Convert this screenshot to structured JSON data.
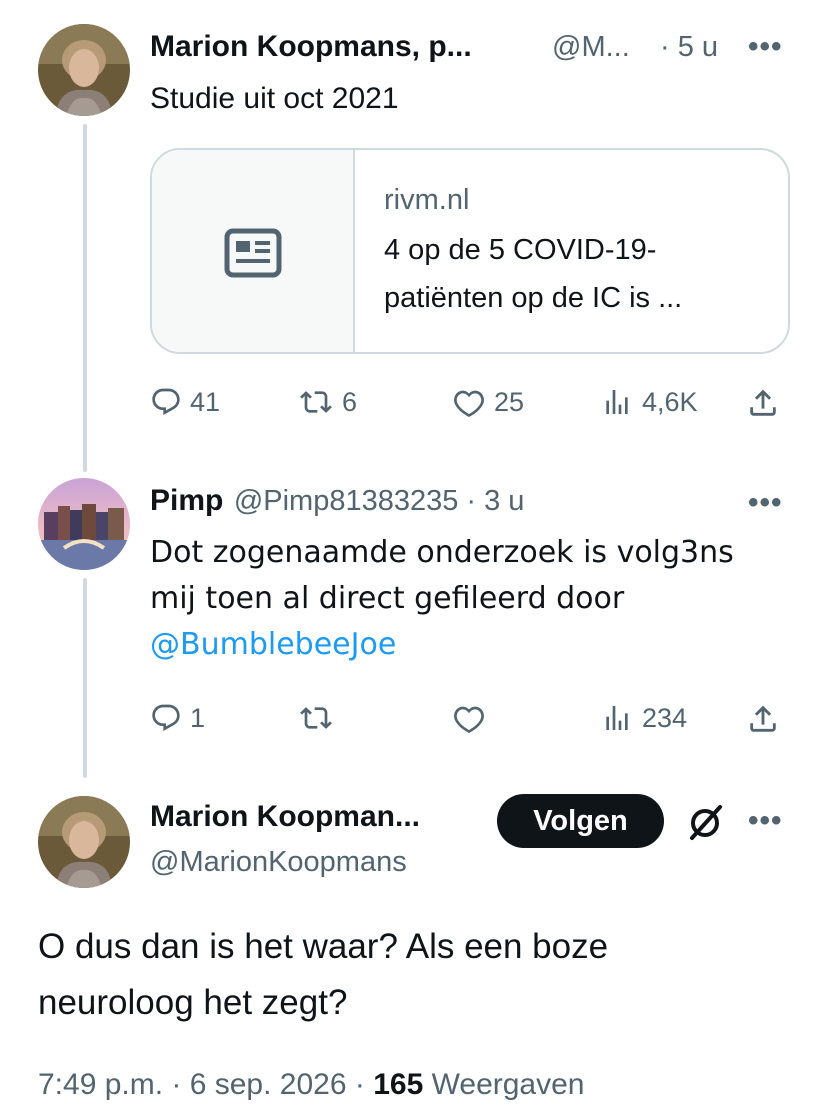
{
  "tweets": [
    {
      "name": "Marion Koopmans, p...",
      "handle": "@M...",
      "time": "· 5 u",
      "text": "Studie uit oct 2021",
      "card": {
        "domain": "rivm.nl",
        "title_line1": "4 op de 5 COVID-19-",
        "title_line2": "patiënten op de IC is ..."
      },
      "actions": {
        "replies": "41",
        "reposts": "6",
        "likes": "25",
        "views": "4,6K"
      }
    },
    {
      "name": "Pimp",
      "handle_time": "@Pimp81383235 · 3 u",
      "text_line1": "Dot zogenaamde onderzoek is volg3ns",
      "text_line2": "mij toen al direct gefileerd door",
      "mention": "@BumblebeeJoe",
      "actions": {
        "replies": "1",
        "reposts": "",
        "likes": "",
        "views": "234"
      }
    }
  ],
  "main_tweet": {
    "name": "Marion Koopman...",
    "handle": "@MarionKoopmans",
    "follow_label": "Volgen",
    "text_line1": "O dus dan is het waar? Als een boze",
    "text_line2": "neuroloog het zegt?",
    "timestamp": "7:49 p.m. · 6 sep. 2026 ·",
    "views_count": "165",
    "views_label": "Weergaven"
  },
  "more_glyph": "•••",
  "icons": [
    "reply-icon",
    "repost-icon",
    "like-icon",
    "views-icon",
    "share-icon",
    "article-icon",
    "grok-icon",
    "more-icon"
  ]
}
